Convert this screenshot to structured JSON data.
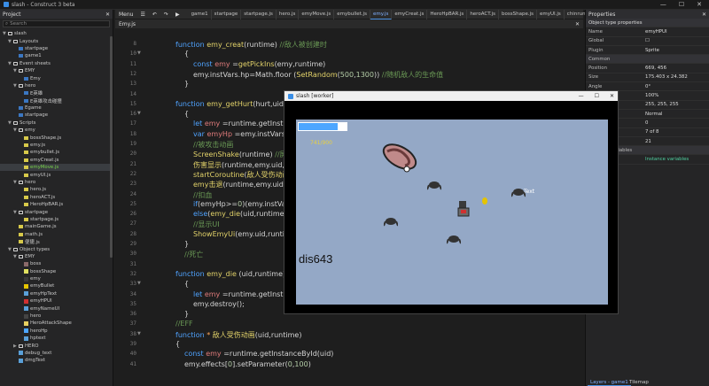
{
  "window": {
    "title": "slash - Construct 3 beta",
    "min": "—",
    "max": "☐",
    "close": "✕"
  },
  "project": {
    "title": "Project",
    "search_placeholder": "Search",
    "tree": [
      {
        "label": "slash",
        "kind": "folder",
        "indent": 0,
        "arrow": "▼"
      },
      {
        "label": "Layouts",
        "kind": "folder",
        "indent": 1,
        "arrow": "▼"
      },
      {
        "label": "startpage",
        "kind": "file",
        "indent": 2
      },
      {
        "label": "game1",
        "kind": "file",
        "indent": 2
      },
      {
        "label": "Event sheets",
        "kind": "folder",
        "indent": 1,
        "arrow": "▼"
      },
      {
        "label": "EMY",
        "kind": "folder",
        "indent": 2,
        "arrow": "▼"
      },
      {
        "label": "Emy",
        "kind": "file",
        "indent": 3
      },
      {
        "label": "hero",
        "kind": "folder",
        "indent": 2,
        "arrow": "▼"
      },
      {
        "label": "E英雄",
        "kind": "file",
        "indent": 3
      },
      {
        "label": "E英雄攻击碰撞",
        "kind": "file",
        "indent": 3
      },
      {
        "label": "Egame",
        "kind": "file",
        "indent": 2
      },
      {
        "label": "startpage",
        "kind": "file",
        "indent": 2
      },
      {
        "label": "Scripts",
        "kind": "folder",
        "indent": 1,
        "arrow": "▼"
      },
      {
        "label": "emy",
        "kind": "folder",
        "indent": 2,
        "arrow": "▼"
      },
      {
        "label": "bossShape.js",
        "kind": "js",
        "indent": 3
      },
      {
        "label": "emy.js",
        "kind": "js",
        "indent": 3
      },
      {
        "label": "emybullet.js",
        "kind": "js",
        "indent": 3
      },
      {
        "label": "emyCreat.js",
        "kind": "js",
        "indent": 3
      },
      {
        "label": "emyMove.js",
        "kind": "js",
        "indent": 3,
        "sel": true
      },
      {
        "label": "emyUI.js",
        "kind": "js",
        "indent": 3
      },
      {
        "label": "hero",
        "kind": "folder",
        "indent": 2,
        "arrow": "▼"
      },
      {
        "label": "hero.js",
        "kind": "js",
        "indent": 3
      },
      {
        "label": "heroACT.js",
        "kind": "js",
        "indent": 3
      },
      {
        "label": "HeroHpBAR.js",
        "kind": "js",
        "indent": 3
      },
      {
        "label": "startpage",
        "kind": "folder",
        "indent": 2,
        "arrow": "▼"
      },
      {
        "label": "startpage.js",
        "kind": "js",
        "indent": 3
      },
      {
        "label": "mainGame.js",
        "kind": "js",
        "indent": 2
      },
      {
        "label": "math.js",
        "kind": "js",
        "indent": 2
      },
      {
        "label": "便捷.js",
        "kind": "js",
        "indent": 2
      },
      {
        "label": "Object types",
        "kind": "folder",
        "indent": 1,
        "arrow": "▼"
      },
      {
        "label": "EMY",
        "kind": "folder",
        "indent": 2,
        "arrow": "▼"
      },
      {
        "label": "boss",
        "kind": "obj",
        "indent": 3,
        "color": "#8a6a6a"
      },
      {
        "label": "bossShape",
        "kind": "obj",
        "indent": 3,
        "color": "#e0e060"
      },
      {
        "label": "emy",
        "kind": "obj",
        "indent": 3,
        "color": "#3a3a3a"
      },
      {
        "label": "emyBullet",
        "kind": "obj",
        "indent": 3,
        "color": "#e5c400"
      },
      {
        "label": "emyHpText",
        "kind": "obj",
        "indent": 3,
        "color": "#5aa0d8"
      },
      {
        "label": "emyHPUI",
        "kind": "obj",
        "indent": 3,
        "color": "#d03030"
      },
      {
        "label": "emyNameUI",
        "kind": "obj",
        "indent": 3,
        "color": "#5aa0d8"
      },
      {
        "label": "hero",
        "kind": "obj",
        "indent": 3,
        "color": "#444"
      },
      {
        "label": "HeroAttackShape",
        "kind": "obj",
        "indent": 3,
        "color": "#e8d060"
      },
      {
        "label": "heroHp",
        "kind": "obj",
        "indent": 3,
        "color": "#4da6ff"
      },
      {
        "label": "hptext",
        "kind": "obj",
        "indent": 3,
        "color": "#5aa0d8"
      },
      {
        "label": "HERO",
        "kind": "folder",
        "indent": 2,
        "arrow": "▶"
      },
      {
        "label": "debug_text",
        "kind": "obj",
        "indent": 2,
        "color": "#5aa0d8"
      },
      {
        "label": "dmgText",
        "kind": "obj",
        "indent": 2,
        "color": "#5aa0d8"
      }
    ]
  },
  "toolbar": {
    "menu": "Menu",
    "icons": [
      "☰",
      "↶",
      "↷",
      "▶"
    ],
    "tabs": [
      "game1",
      "startpage",
      "startpage.js",
      "hero.js",
      "emyMove.js",
      "emybullet.js",
      "emy.js",
      "emyCreat.js",
      "HeroHpBAR.js",
      "heroACT.js",
      "bossShape.js",
      "emyUI.js",
      "chinrun"
    ],
    "active_tab": "emy.js"
  },
  "editor": {
    "title": "Emy.js",
    "lines": [
      {
        "n": "8",
        "fold": "",
        "html": "<span class='kw'>function</span> <span class='fn'>emy_creat</span>(runtime)  <span class='cm'>//敌人被创建时</span>",
        "indent": 0
      },
      {
        "n": "10",
        "fold": "▼",
        "html": "{",
        "indent": 1
      },
      {
        "n": "11",
        "fold": "",
        "html": "<span class='kw'>const</span> <span class='cm2'>emy</span> =<span class='fn'>getPickIns</span>(emy,runtime)",
        "indent": 2
      },
      {
        "n": "12",
        "fold": "",
        "html": "emy.instVars.hp=Math.floor (<span class='fn'>SetRandom</span>(<span class='nm'>500</span>,<span class='nm'>1300</span>)) <span class='cm'>//随机敌人的生命值</span>",
        "indent": 2
      },
      {
        "n": "13",
        "fold": "",
        "html": "}",
        "indent": 1
      },
      {
        "n": "14",
        "fold": "",
        "html": "",
        "indent": 0
      },
      {
        "n": "15",
        "fold": "",
        "html": "<span class='kw'>function</span> <span class='fn'>emy_getHurt</span>(hurt,uid,runtime)",
        "indent": 0
      },
      {
        "n": "16",
        "fold": "▼",
        "html": "{",
        "indent": 1
      },
      {
        "n": "17",
        "fold": "",
        "html": "<span class='kw'>let</span> <span class='cm2'>emy</span> =runtime.getInstanceById(uid)",
        "indent": 2
      },
      {
        "n": "18",
        "fold": "",
        "html": "<span class='kw'>var</span> <span class='cm2'>emyHp</span> =emy.instVars.hp",
        "indent": 2
      },
      {
        "n": "19",
        "fold": "",
        "html": "<span class='cm'>//被攻击动画</span>",
        "indent": 2
      },
      {
        "n": "20",
        "fold": "",
        "html": "<span class='fn'>ScreenShake</span>(runtime)  <span class='cm'>//屏幕抖动</span>",
        "indent": 2
      },
      {
        "n": "21",
        "fold": "",
        "html": "<span class='fn'>伤害显示</span>(runtime,emy.uid,hurt)",
        "indent": 2
      },
      {
        "n": "22",
        "fold": "",
        "html": "<span class='fn'>startCoroutine</span>(<span class='fn'>敌人受伤动画</span>(emy.uid,runtime))",
        "indent": 2
      },
      {
        "n": "23",
        "fold": "",
        "html": "<span class='fn'>emy击退</span>(runtime,emy.uid)",
        "indent": 2
      },
      {
        "n": "24",
        "fold": "",
        "html": "<span class='cm'>//扣血</span>",
        "indent": 2
      },
      {
        "n": "25",
        "fold": "",
        "html": "<span class='kw'>if</span>(emyHp>=<span class='nm'>0</span>)(emy.instVars.hp-=hurt)",
        "indent": 2
      },
      {
        "n": "26",
        "fold": "",
        "html": "<span class='kw'>else</span>(<span class='fn'>emy_die</span>(uid,runtime);)",
        "indent": 2
      },
      {
        "n": "27",
        "fold": "",
        "html": "<span class='cm'>//显示UI</span>",
        "indent": 2
      },
      {
        "n": "28",
        "fold": "",
        "html": "<span class='fn'>ShowEmyUi</span>(emy.uid,runtime)",
        "indent": 2
      },
      {
        "n": "29",
        "fold": "",
        "html": "}",
        "indent": 1
      },
      {
        "n": "30",
        "fold": "",
        "html": "<span class='cm'>//死亡</span>",
        "indent": 1
      },
      {
        "n": "31",
        "fold": "",
        "html": "",
        "indent": 0
      },
      {
        "n": "32",
        "fold": "",
        "html": "<span class='kw'>function</span> <span class='fn'>emy_die</span> (uid,runtime)",
        "indent": 0
      },
      {
        "n": "33",
        "fold": "▼",
        "html": "{",
        "indent": 1
      },
      {
        "n": "34",
        "fold": "",
        "html": "<span class='kw'>let</span> <span class='cm2'>emy</span> =runtime.getInstanceById(uid)",
        "indent": 2
      },
      {
        "n": "35",
        "fold": "",
        "html": "emy.destroy();",
        "indent": 2
      },
      {
        "n": "36",
        "fold": "",
        "html": "}",
        "indent": 1
      },
      {
        "n": "37",
        "fold": "",
        "html": "<span class='cm'>//EFF</span>",
        "indent": 0
      },
      {
        "n": "38",
        "fold": "▼",
        "html": "<span class='kw'>function</span> <span class='cn'>*</span> <span class='fn'>敌人受伤动画</span>(uid,runtime)",
        "indent": 0
      },
      {
        "n": "39",
        "fold": "",
        "html": "{",
        "indent": 0
      },
      {
        "n": "40",
        "fold": "",
        "html": "<span class='kw'>const</span> <span class='cm2'>emy</span> =runtime.getInstanceById(uid)",
        "indent": 1
      },
      {
        "n": "41",
        "fold": "",
        "html": "emy.effects[<span class='nm'>0</span>].setParameter(<span class='nm'>0</span>,<span class='nm'>100</span>)",
        "indent": 1
      }
    ]
  },
  "props": {
    "title": "Properties",
    "subtitle": "Object type properties",
    "rows": [
      {
        "k": "Name",
        "v": "emyHPUI"
      },
      {
        "k": "Global",
        "v": "☐"
      },
      {
        "k": "Plugin",
        "v": "Sprite"
      },
      {
        "k": "Common",
        "v": "",
        "sec": true
      },
      {
        "k": "Position",
        "v": "669, 456"
      },
      {
        "k": "Size",
        "v": "175.403 x 24.382"
      },
      {
        "k": "Angle",
        "v": "0°"
      },
      {
        "k": "Opacity",
        "v": "100%"
      },
      {
        "k": "Color",
        "v": "255, 255, 255"
      },
      {
        "k": "Blend mode",
        "v": "Normal"
      },
      {
        "k": "Z elevation",
        "v": "0"
      },
      {
        "k": "",
        "v": "7 of 8"
      },
      {
        "k": "",
        "v": "21"
      },
      {
        "k": "Instance variables",
        "v": "",
        "sec": true
      },
      {
        "k": "",
        "v": "Instance variables"
      }
    ],
    "bottom_tabs": [
      "Layers - game1",
      "Tilemap"
    ]
  },
  "preview": {
    "title": "slash [worker]",
    "hp_text": "741/900",
    "hp_fraction": 0.82,
    "debug_text": "dis643",
    "float_text": "Text"
  }
}
